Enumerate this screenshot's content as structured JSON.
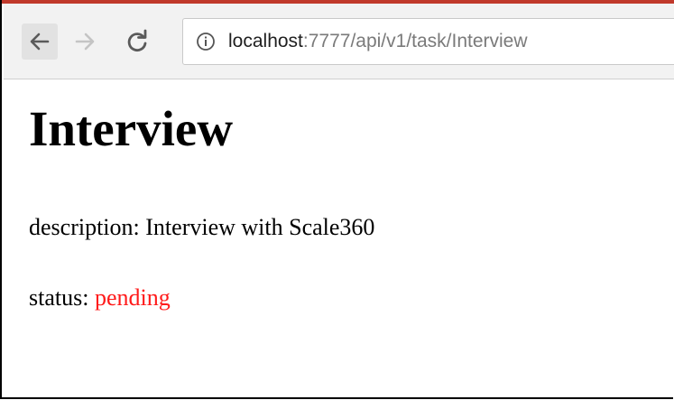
{
  "browser": {
    "address_bar": {
      "host": "localhost",
      "path": ":7777/api/v1/task/Interview"
    },
    "icons": {
      "back": "arrow-left-icon",
      "forward": "arrow-right-icon",
      "reload": "reload-icon",
      "info": "info-icon"
    },
    "accent_color": "#c0392b"
  },
  "page": {
    "title": "Interview",
    "description_label": "description:",
    "description_value": "Interview with Scale360",
    "status_label": "status:",
    "status_value": "pending",
    "status_color": "#ff1a1a"
  }
}
